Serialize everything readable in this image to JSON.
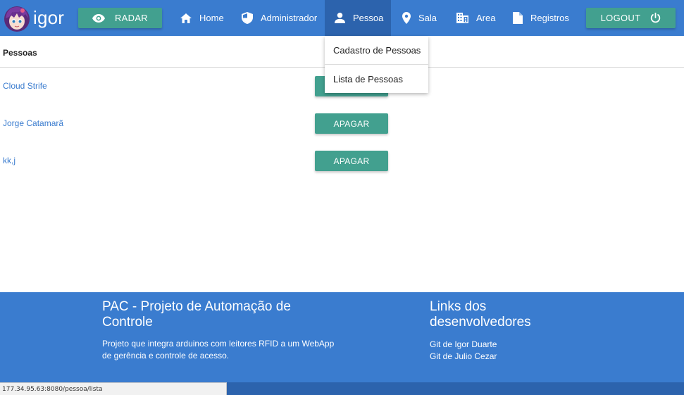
{
  "navbar": {
    "logo_text": "igor",
    "radar_label": "RADAR",
    "logout_label": "LOGOUT",
    "items": [
      {
        "label": "Home",
        "icon": "home-icon"
      },
      {
        "label": "Administrador",
        "icon": "shield-icon"
      },
      {
        "label": "Pessoa",
        "icon": "person-icon",
        "active": true
      },
      {
        "label": "Sala",
        "icon": "location-pin-icon"
      },
      {
        "label": "Area",
        "icon": "building-icon"
      },
      {
        "label": "Registros",
        "icon": "document-icon"
      }
    ]
  },
  "dropdown": {
    "items": [
      "Cadastro de Pessoas",
      "Lista de Pessoas"
    ]
  },
  "main": {
    "title": "Pessoas",
    "rows": [
      {
        "name": "Cloud Strife",
        "action": "APAGAR"
      },
      {
        "name": "Jorge Catamarã",
        "action": "APAGAR"
      },
      {
        "name": "kk,j",
        "action": "APAGAR"
      }
    ]
  },
  "footer": {
    "left_title": "PAC - Projeto de Automação de Controle",
    "left_text": "Projeto que integra arduinos com leitores RFID a um WebApp de gerência e controle de acesso.",
    "right_title": "Links dos desenvolvedores",
    "links": [
      "Git de Igor Duarte",
      "Git de Julio Cezar"
    ]
  },
  "status_bar": {
    "url": "177.34.95.63:8080/pessoa/lista"
  },
  "colors": {
    "navbar": "#3a7ccf",
    "navbar_active": "#2c63ad",
    "button": "#42a08f",
    "link": "#3a7ccf"
  }
}
